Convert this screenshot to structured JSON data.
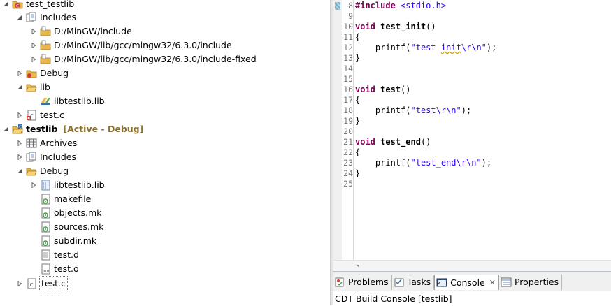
{
  "explorer": {
    "project1": {
      "name": "test_testlib",
      "includes": "Includes",
      "include_paths": [
        "D:/MinGW/include",
        "D:/MinGW/lib/gcc/mingw32/6.3.0/include",
        "D:/MinGW/lib/gcc/mingw32/6.3.0/include-fixed"
      ],
      "debug": "Debug",
      "lib": "lib",
      "lib_file": "libtestlib.lib",
      "source": "test.c"
    },
    "project2": {
      "name": "testlib",
      "status": "[Active - Debug]",
      "archives": "Archives",
      "includes": "Includes",
      "debug": "Debug",
      "debug_files": [
        "libtestlib.lib",
        "makefile",
        "objects.mk",
        "sources.mk",
        "subdir.mk",
        "test.d",
        "test.o"
      ],
      "source": "test.c"
    }
  },
  "editor": {
    "lines": [
      {
        "n": "8",
        "text": "#include <stdio.h>"
      },
      {
        "n": "9",
        "text": ""
      },
      {
        "n": "10",
        "text": "void test_init()"
      },
      {
        "n": "11",
        "text": "{"
      },
      {
        "n": "12",
        "text": "    printf(\"test init\\r\\n\");"
      },
      {
        "n": "13",
        "text": "}"
      },
      {
        "n": "14",
        "text": ""
      },
      {
        "n": "15",
        "text": ""
      },
      {
        "n": "16",
        "text": "void test()"
      },
      {
        "n": "17",
        "text": "{"
      },
      {
        "n": "18",
        "text": "    printf(\"test\\r\\n\");"
      },
      {
        "n": "19",
        "text": "}"
      },
      {
        "n": "20",
        "text": ""
      },
      {
        "n": "21",
        "text": "void test_end()"
      },
      {
        "n": "22",
        "text": "{"
      },
      {
        "n": "23",
        "text": "    printf(\"test_end\\r\\n\");"
      },
      {
        "n": "24",
        "text": "}"
      },
      {
        "n": "25",
        "text": ""
      }
    ],
    "tokens": {
      "include_kw": "#include",
      "include_hdr": "<stdio.h>",
      "void": "void",
      "printf": "printf",
      "fn_init": "test_init",
      "fn_test": "test",
      "fn_end": "test_end",
      "parens": "()",
      "open_brace": "{",
      "close_brace": "}",
      "indent": "    ",
      "lparen": "(",
      "rparen_semi": ");",
      "str_init_a": "\"test ",
      "str_init_b": "init",
      "str_init_c": "\\r\\n\"",
      "str_test": "\"test\\r\\n\"",
      "str_end": "\"test_end\\r\\n\""
    },
    "scroll_left_arrow": "◂"
  },
  "panel": {
    "tabs": [
      {
        "label": "Problems",
        "icon": "problems-icon"
      },
      {
        "label": "Tasks",
        "icon": "tasks-icon"
      },
      {
        "label": "Console",
        "icon": "console-icon",
        "active": true,
        "close": "✕"
      },
      {
        "label": "Properties",
        "icon": "properties-icon"
      }
    ],
    "console_title": "CDT Build Console [testlib]"
  },
  "colors": {
    "keyword": "#7f0055",
    "string": "#2a00ff",
    "status": "#8b6f2e",
    "line_number": "#787878",
    "folder": "#e8b64a"
  }
}
